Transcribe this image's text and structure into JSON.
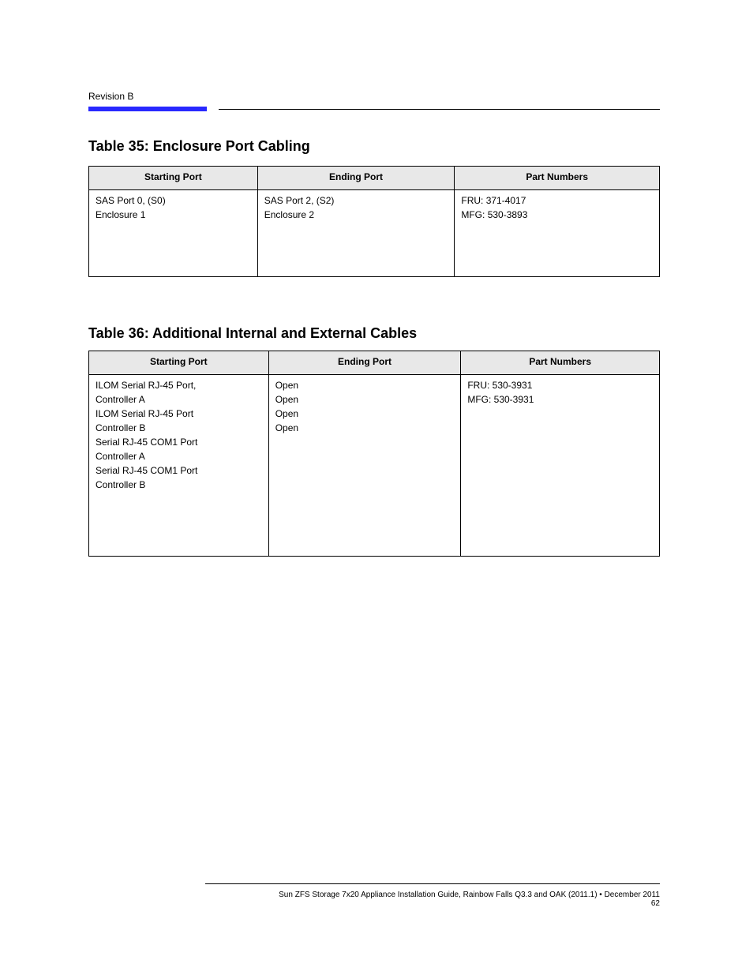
{
  "header": {
    "label": "Revision B"
  },
  "section1": {
    "title": "Table 35: Enclosure Port Cabling",
    "headers": [
      "Starting Port",
      "Ending Port",
      "Part Numbers"
    ],
    "rows": [
      {
        "start": [
          "SAS Port 0, (S0)",
          "Enclosure 1"
        ],
        "end": [
          "SAS Port 2, (S2)",
          "Enclosure 2"
        ],
        "parts": [
          "FRU: 371-4017",
          "MFG: 530-3893"
        ]
      }
    ]
  },
  "section2": {
    "title": "Table 36: Additional Internal and External Cables",
    "headers": [
      "Starting Port",
      "Ending Port",
      "Part Numbers"
    ],
    "rows": [
      {
        "start": [
          "ILOM Serial RJ-45 Port,",
          "Controller A",
          "",
          "ILOM Serial RJ-45 Port",
          "Controller B",
          "",
          "Serial RJ-45 COM1 Port",
          "Controller A",
          "",
          "Serial RJ-45 COM1 Port",
          "Controller B"
        ],
        "end": [
          "Open",
          "",
          "",
          "Open",
          "",
          "",
          "Open",
          "",
          "",
          "Open"
        ],
        "parts": [
          "FRU: 530-3931",
          "MFG: 530-3931"
        ]
      }
    ]
  },
  "footer": {
    "line1": "Sun ZFS Storage 7x20 Appliance Installation Guide, Rainbow Falls Q3.3 and OAK (2011.1) • December 2011",
    "line2": "62"
  }
}
